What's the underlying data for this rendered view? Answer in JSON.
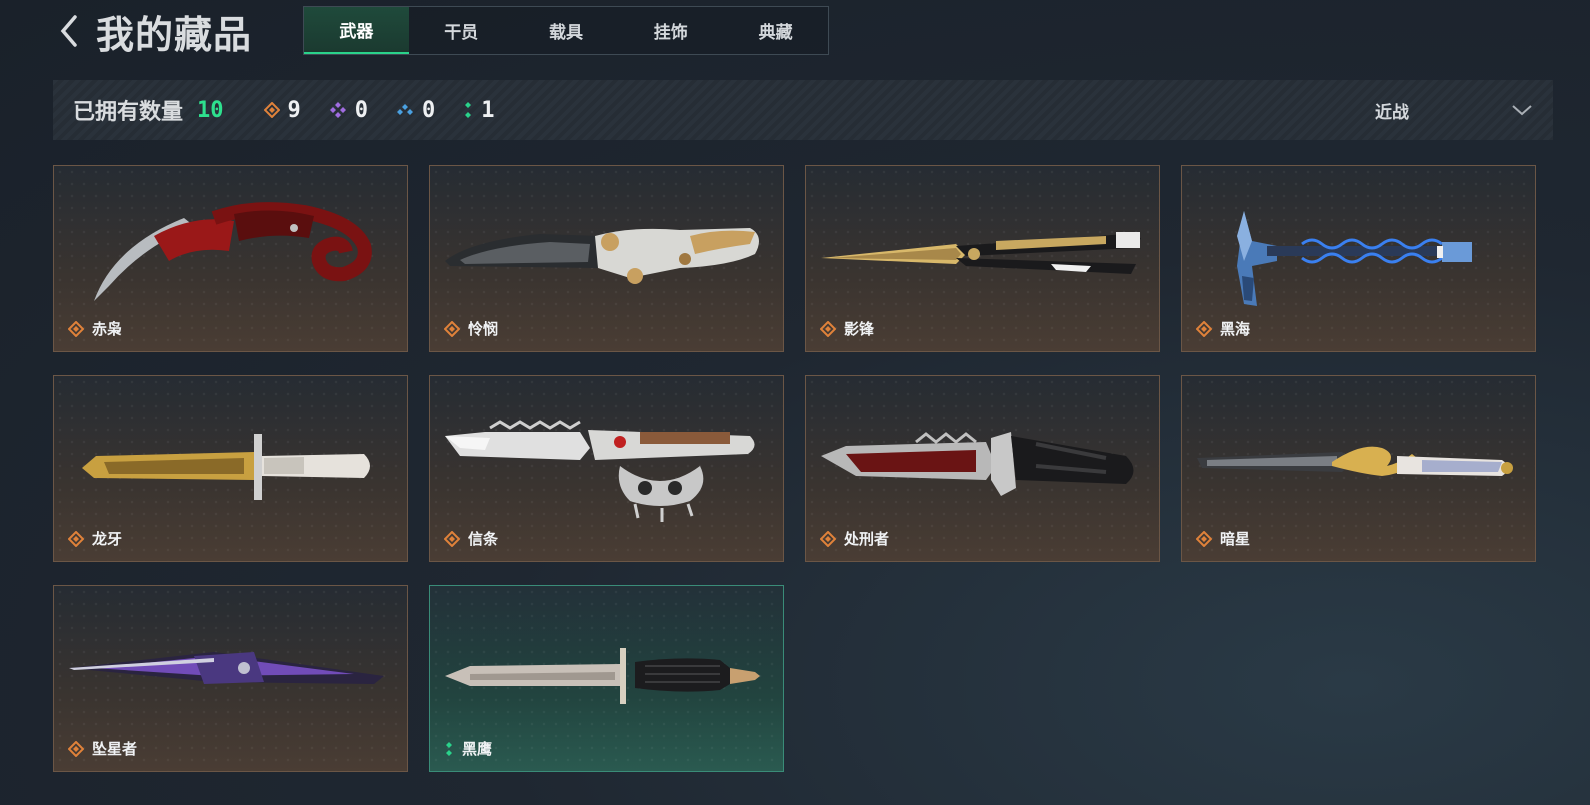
{
  "header": {
    "title": "我的藏品"
  },
  "tabs": [
    {
      "label": "武器",
      "active": true
    },
    {
      "label": "干员",
      "active": false
    },
    {
      "label": "载具",
      "active": false
    },
    {
      "label": "挂饰",
      "active": false
    },
    {
      "label": "典藏",
      "active": false
    }
  ],
  "stats": {
    "owned_label": "已拥有数量",
    "owned_count": "10",
    "rarities": [
      {
        "icon": "orange-diamond-icon",
        "color": "#e0823a",
        "count": "9"
      },
      {
        "icon": "purple-diamond-icon",
        "color": "#a06ce0",
        "count": "0"
      },
      {
        "icon": "blue-diamond-icon",
        "color": "#4aa0e0",
        "count": "0"
      },
      {
        "icon": "green-diamond-icon",
        "color": "#2ad38b",
        "count": "1"
      }
    ]
  },
  "filter": {
    "selected": "近战",
    "icon": "chevron-down-icon"
  },
  "items": [
    {
      "name": "赤枭",
      "rarity": "orange"
    },
    {
      "name": "怜悯",
      "rarity": "orange"
    },
    {
      "name": "影锋",
      "rarity": "orange"
    },
    {
      "name": "黑海",
      "rarity": "orange"
    },
    {
      "name": "龙牙",
      "rarity": "orange"
    },
    {
      "name": "信条",
      "rarity": "orange"
    },
    {
      "name": "处刑者",
      "rarity": "orange"
    },
    {
      "name": "暗星",
      "rarity": "orange"
    },
    {
      "name": "坠星者",
      "rarity": "orange"
    },
    {
      "name": "黑鹰",
      "rarity": "green"
    }
  ],
  "colors": {
    "accent": "#2ad38b",
    "orange": "#e0823a"
  }
}
